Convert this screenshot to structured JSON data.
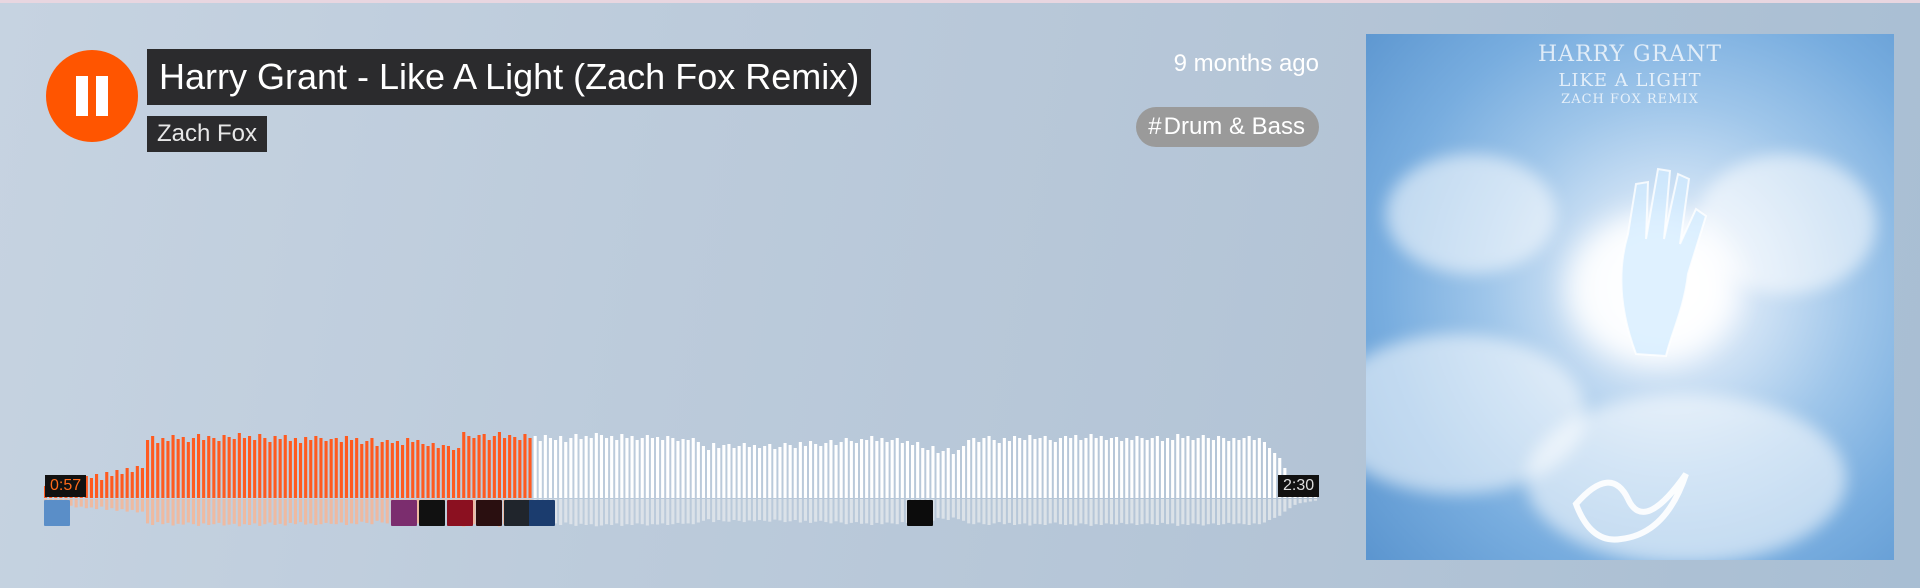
{
  "track": {
    "title": "Harry Grant - Like A Light (Zach Fox Remix)",
    "artist": "Zach Fox",
    "posted": "9 months ago",
    "genre_hash": "#",
    "genre": "Drum & Bass"
  },
  "player": {
    "state": "playing",
    "current_time": "0:57",
    "duration": "2:30",
    "progress": 0.38,
    "accent_color": "#ff5500",
    "played_color": "#ff5a1f",
    "unplayed_color": "#ffffff"
  },
  "artwork": {
    "line1": "HARRY GRANT",
    "line2": "LIKE A LIGHT",
    "line3": "ZACH FOX REMIX"
  },
  "waveform": {
    "heights": [
      0.12,
      0.14,
      0.16,
      0.14,
      0.18,
      0.16,
      0.2,
      0.18,
      0.22,
      0.2,
      0.24,
      0.18,
      0.26,
      0.22,
      0.28,
      0.24,
      0.3,
      0.26,
      0.32,
      0.3,
      0.58,
      0.62,
      0.55,
      0.6,
      0.57,
      0.63,
      0.59,
      0.61,
      0.56,
      0.6,
      0.64,
      0.58,
      0.62,
      0.6,
      0.57,
      0.63,
      0.61,
      0.59,
      0.65,
      0.6,
      0.62,
      0.58,
      0.64,
      0.6,
      0.56,
      0.62,
      0.59,
      0.63,
      0.57,
      0.6,
      0.55,
      0.61,
      0.58,
      0.62,
      0.6,
      0.57,
      0.59,
      0.6,
      0.56,
      0.62,
      0.58,
      0.6,
      0.54,
      0.57,
      0.6,
      0.52,
      0.56,
      0.58,
      0.55,
      0.57,
      0.53,
      0.6,
      0.56,
      0.58,
      0.54,
      0.52,
      0.55,
      0.5,
      0.53,
      0.52,
      0.48,
      0.5,
      0.66,
      0.62,
      0.6,
      0.63,
      0.64,
      0.58,
      0.62,
      0.66,
      0.6,
      0.63,
      0.61,
      0.58,
      0.64,
      0.6,
      0.62,
      0.57,
      0.63,
      0.6,
      0.58,
      0.62,
      0.56,
      0.6,
      0.64,
      0.59,
      0.62,
      0.6,
      0.65,
      0.63,
      0.6,
      0.62,
      0.58,
      0.64,
      0.6,
      0.62,
      0.58,
      0.6,
      0.63,
      0.6,
      0.61,
      0.58,
      0.62,
      0.6,
      0.57,
      0.59,
      0.58,
      0.6,
      0.56,
      0.52,
      0.48,
      0.55,
      0.5,
      0.53,
      0.54,
      0.5,
      0.52,
      0.55,
      0.51,
      0.53,
      0.5,
      0.52,
      0.54,
      0.49,
      0.51,
      0.55,
      0.53,
      0.5,
      0.56,
      0.52,
      0.57,
      0.54,
      0.52,
      0.55,
      0.58,
      0.53,
      0.56,
      0.6,
      0.57,
      0.55,
      0.59,
      0.58,
      0.62,
      0.57,
      0.6,
      0.56,
      0.58,
      0.6,
      0.55,
      0.57,
      0.53,
      0.56,
      0.5,
      0.48,
      0.52,
      0.45,
      0.47,
      0.5,
      0.44,
      0.48,
      0.52,
      0.58,
      0.6,
      0.56,
      0.6,
      0.62,
      0.58,
      0.55,
      0.6,
      0.57,
      0.62,
      0.6,
      0.58,
      0.63,
      0.59,
      0.6,
      0.62,
      0.58,
      0.56,
      0.6,
      0.62,
      0.6,
      0.63,
      0.58,
      0.6,
      0.64,
      0.6,
      0.62,
      0.58,
      0.6,
      0.61,
      0.57,
      0.6,
      0.58,
      0.62,
      0.6,
      0.58,
      0.6,
      0.62,
      0.57,
      0.6,
      0.58,
      0.64,
      0.6,
      0.62,
      0.58,
      0.6,
      0.63,
      0.6,
      0.58,
      0.62,
      0.6,
      0.57,
      0.6,
      0.58,
      0.6,
      0.62,
      0.58,
      0.6,
      0.56,
      0.5,
      0.45,
      0.4,
      0.3,
      0.22,
      0.14,
      0.1,
      0.08,
      0.06,
      0.04
    ]
  },
  "comment_avatars": [
    {
      "name": "avatar-user-1",
      "color": "#5a8ec8",
      "t": 0.0
    },
    {
      "name": "avatar-user-2",
      "color": "#7b2d6e",
      "t": 0.272
    },
    {
      "name": "avatar-user-3",
      "color": "#111111",
      "t": 0.294
    },
    {
      "name": "avatar-user-4",
      "color": "#8b1020",
      "t": 0.316
    },
    {
      "name": "avatar-user-5",
      "color": "#2a0f10",
      "t": 0.339
    },
    {
      "name": "avatar-user-6",
      "color": "#20252c",
      "t": 0.361
    },
    {
      "name": "avatar-user-7",
      "color": "#1b3c6e",
      "t": 0.38
    },
    {
      "name": "avatar-user-8",
      "color": "#0c0c0c",
      "t": 0.677
    }
  ]
}
